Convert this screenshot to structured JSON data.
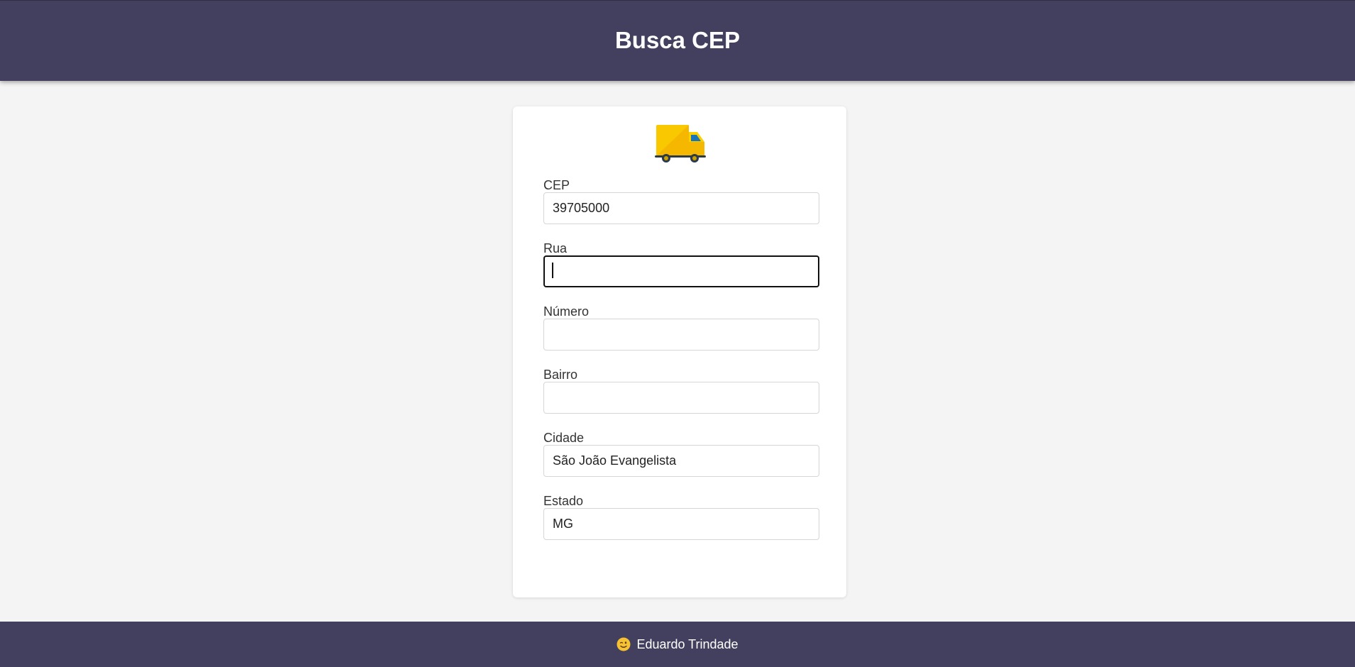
{
  "header": {
    "title": "Busca CEP"
  },
  "form": {
    "logo_icon": "truck-icon",
    "fields": [
      {
        "label": "CEP",
        "value": "39705000",
        "placeholder": ""
      },
      {
        "label": "Rua",
        "value": "",
        "placeholder": "",
        "focused": true
      },
      {
        "label": "Número",
        "value": "",
        "placeholder": ""
      },
      {
        "label": "Bairro",
        "value": "",
        "placeholder": ""
      },
      {
        "label": "Cidade",
        "value": "São João Evangelista",
        "placeholder": ""
      },
      {
        "label": "Estado",
        "value": "MG",
        "placeholder": ""
      }
    ]
  },
  "footer": {
    "emoji_icon": "winking-face-icon",
    "author": "Eduardo Trindade"
  },
  "colors": {
    "header_bg": "#42405e",
    "page_bg": "#f4f4f4",
    "truck_yellow": "#f9c800"
  }
}
